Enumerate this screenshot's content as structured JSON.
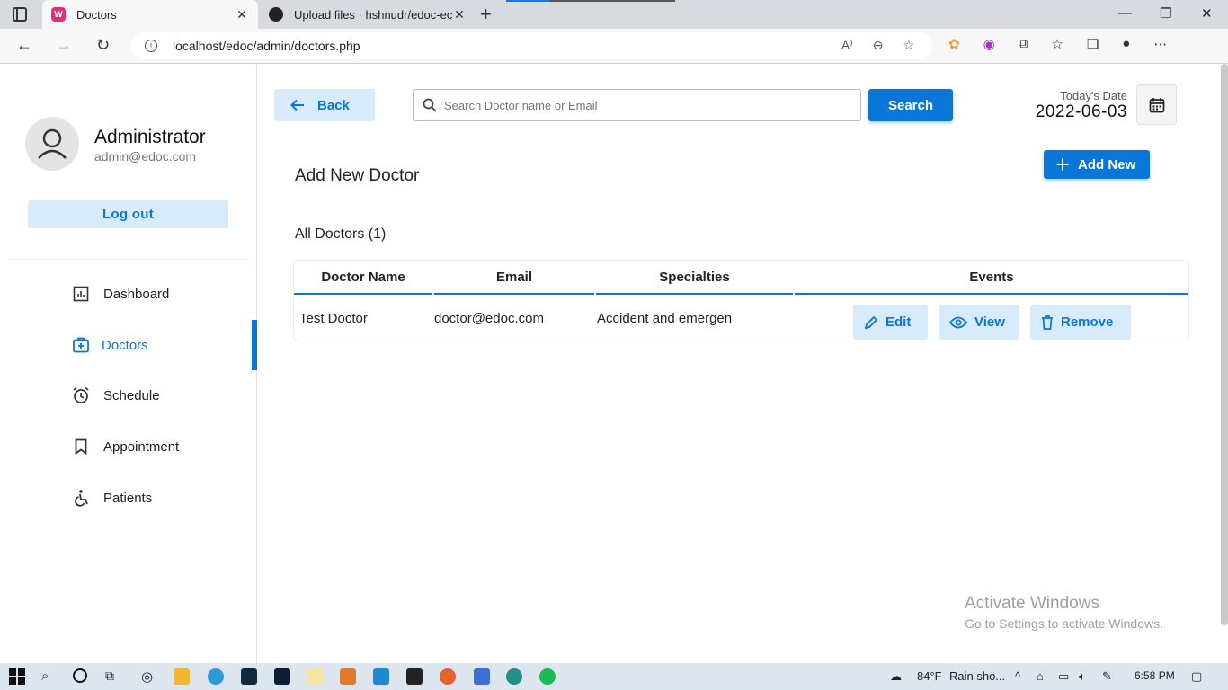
{
  "browser": {
    "tabs": [
      {
        "title": "Doctors",
        "active": true
      },
      {
        "title": "Upload files · hshnudr/edoc-echa",
        "active": false
      }
    ],
    "url": "localhost/edoc/admin/doctors.php"
  },
  "sidebar": {
    "profile": {
      "name": "Administrator",
      "email": "admin@edoc.com"
    },
    "logout_label": "Log out",
    "items": [
      {
        "label": "Dashboard",
        "icon": "dashboard-icon"
      },
      {
        "label": "Doctors",
        "icon": "doctor-icon",
        "active": true
      },
      {
        "label": "Schedule",
        "icon": "clock-icon"
      },
      {
        "label": "Appointment",
        "icon": "bookmark-icon"
      },
      {
        "label": "Patients",
        "icon": "wheelchair-icon"
      }
    ]
  },
  "header": {
    "back_label": "Back",
    "search_placeholder": "Search Doctor name or Email",
    "search_label": "Search",
    "date_label": "Today's Date",
    "date_value": "2022-06-03"
  },
  "main": {
    "add_title": "Add New Doctor",
    "add_new_label": "Add New",
    "list_title": "All Doctors (1)",
    "table": {
      "columns": [
        "Doctor Name",
        "Email",
        "Specialties",
        "Events"
      ],
      "rows": [
        {
          "name": "Test Doctor",
          "email": "doctor@edoc.com",
          "specialty": "Accident and emergen",
          "actions": [
            "Edit",
            "View",
            "Remove"
          ]
        }
      ]
    }
  },
  "watermark": {
    "line1": "Activate Windows",
    "line2": "Go to Settings to activate Windows."
  },
  "taskbar": {
    "weather": "84°F",
    "weather_desc": "Rain sho...",
    "time": "6:58 PM"
  },
  "colors": {
    "accent": "#0a76d8",
    "accent_soft": "#d8ebfa"
  }
}
